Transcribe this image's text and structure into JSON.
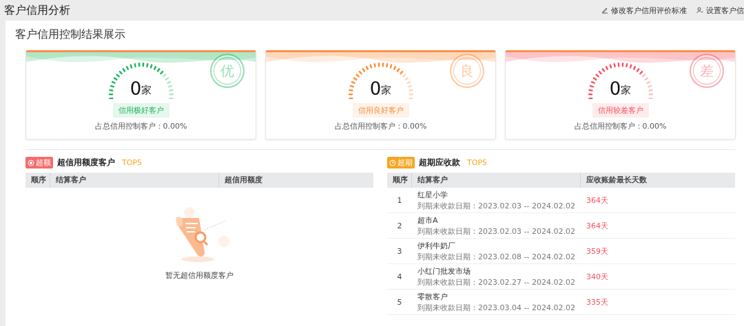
{
  "header": {
    "title": "客户信用分析",
    "actions": [
      {
        "kind": "edit",
        "label": "修改客户信用评价标准"
      },
      {
        "kind": "user",
        "label": "设置客户信"
      }
    ]
  },
  "panel_title": "客户信用控制结果展示",
  "cards": [
    {
      "stamp": "优",
      "count": "0",
      "unit": "家",
      "label": "信用极好客户",
      "share": "占总信用控制客户：0.00%",
      "color": "#1bb55c"
    },
    {
      "stamp": "良",
      "count": "0",
      "unit": "家",
      "label": "信用良好客户",
      "share": "占总信用控制客户：0.00%",
      "color": "#fa8c35"
    },
    {
      "stamp": "差",
      "count": "0",
      "unit": "家",
      "label": "信用较差客户",
      "share": "占总信用控制客户：0.00%",
      "color": "#f5515f"
    }
  ],
  "sections": [
    {
      "kind": "over_limit",
      "badge": "超额",
      "title": "超信用额度客户",
      "top": "TOP5",
      "columns": [
        "顺序",
        "结算客户",
        "超信用额度"
      ],
      "empty_text": "暂无超信用额度客户"
    },
    {
      "kind": "overdue",
      "badge": "超期",
      "title": "超期应收款",
      "top": "TOP5",
      "columns": [
        "顺序",
        "结算客户",
        "应收账龄最长天数"
      ],
      "rows": [
        {
          "index": "1",
          "customer": "红星小学",
          "period": "到期未收款日期：2023.02.03 -- 2024.02.02",
          "days": "364天"
        },
        {
          "index": "2",
          "customer": "超市A",
          "period": "到期未收款日期：2023.02.03 -- 2024.02.02",
          "days": "364天"
        },
        {
          "index": "3",
          "customer": "伊利牛奶厂",
          "period": "到期未收款日期：2023.02.08 -- 2024.02.02",
          "days": "359天"
        },
        {
          "index": "4",
          "customer": "小红门批发市场",
          "period": "到期未收款日期：2023.02.27 -- 2024.02.02",
          "days": "340天"
        },
        {
          "index": "5",
          "customer": "零散客户",
          "period": "到期未收款日期：2023.03.04 -- 2024.02.02",
          "days": "335天"
        }
      ]
    }
  ]
}
